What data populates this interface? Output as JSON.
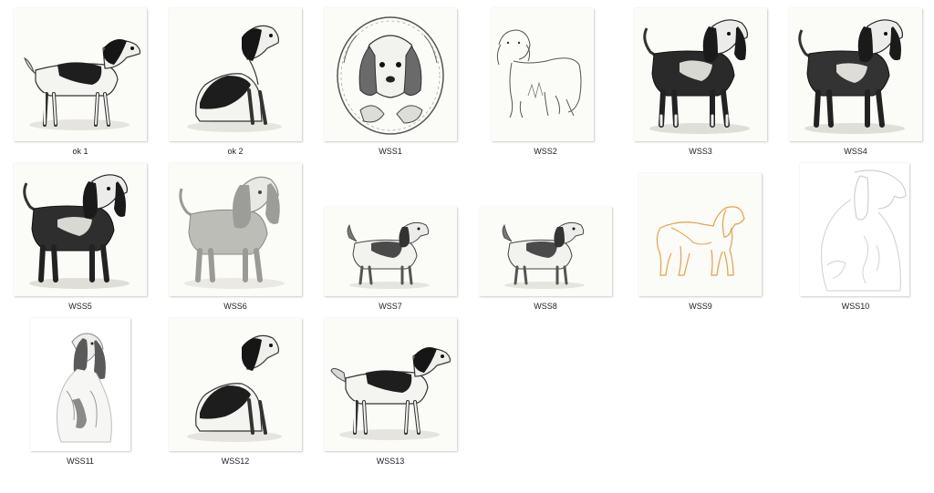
{
  "files": [
    {
      "name": "ok 1",
      "style": "sketch-dark-spots-standing-right"
    },
    {
      "name": "ok 2",
      "style": "sketch-dark-sitting"
    },
    {
      "name": "WSS1",
      "style": "engraving-portrait-wreath"
    },
    {
      "name": "WSS2",
      "style": "line-art-outline"
    },
    {
      "name": "WSS3",
      "style": "etching-black-coat-standing"
    },
    {
      "name": "WSS4",
      "style": "etching-black-coat-standing"
    },
    {
      "name": "WSS5",
      "style": "etching-black-coat-standing"
    },
    {
      "name": "WSS6",
      "style": "pencil-grey-standing"
    },
    {
      "name": "WSS7",
      "style": "small-sketch-standing-landscape"
    },
    {
      "name": "WSS8",
      "style": "small-sketch-standing-landscape"
    },
    {
      "name": "WSS9",
      "style": "orange-outline"
    },
    {
      "name": "WSS10",
      "style": "faint-outline-sitting"
    },
    {
      "name": "WSS11",
      "style": "faint-sketch-sitting-portrait"
    },
    {
      "name": "WSS12",
      "style": "sketch-dark-sitting"
    },
    {
      "name": "WSS13",
      "style": "sketch-dark-spots-standing-right"
    }
  ]
}
